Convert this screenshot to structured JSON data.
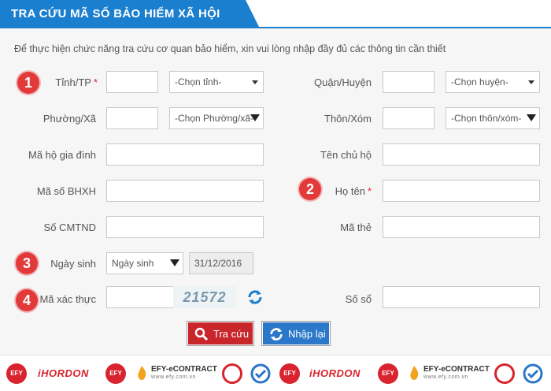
{
  "header": {
    "title": "TRA CỨU MÃ SỐ BẢO HIỂM XÃ HỘI"
  },
  "intro": "Để thực hiện chức năng tra cứu cơ quan bảo hiểm, xin vui lòng nhập đầy đủ các thông tin cần thiết",
  "badges": [
    "1",
    "2",
    "3",
    "4"
  ],
  "form": {
    "tinh_label": "Tỉnh/TP",
    "tinh_select": "-Chọn tỉnh-",
    "quan_label": "Quận/Huyện",
    "quan_select": "-Chọn huyện-",
    "phuong_label": "Phường/Xã",
    "phuong_select": "-Chọn Phường/xã-",
    "thon_label": "Thôn/Xóm",
    "thon_select": "-Chọn thôn/xóm-",
    "maho_label": "Mã hộ gia đình",
    "tenchuho_label": "Tên chủ hộ",
    "mabhxh_label": "Mã số BHXH",
    "hoten_label": "Họ tên",
    "cmtnd_label": "Số CMTND",
    "mathe_label": "Mã thẻ",
    "ngaysinh_label": "Ngày sinh",
    "ngaysinh_select": "Ngày sinh",
    "ngaysinh_date": "31/12/2016",
    "captcha_label": "Mã xác thực",
    "captcha_code": "21572",
    "soso_label": "Số sổ",
    "required_mark": "*"
  },
  "buttons": {
    "search": "Tra cứu",
    "reset": "Nhập lại"
  },
  "footer_logos": [
    "EFY",
    "iHORDON",
    "EFY",
    "EFY-eCONTRACT",
    "www.efy.com.vn",
    "EFY",
    "iHORDON",
    "EFY",
    "EFY-eCONTRACT",
    "www.efy.com.vn"
  ],
  "colors": {
    "header": "#1a7fcf",
    "badge": "#e23a3a",
    "search_btn": "#c8262b",
    "reset_btn": "#2b77c9"
  }
}
